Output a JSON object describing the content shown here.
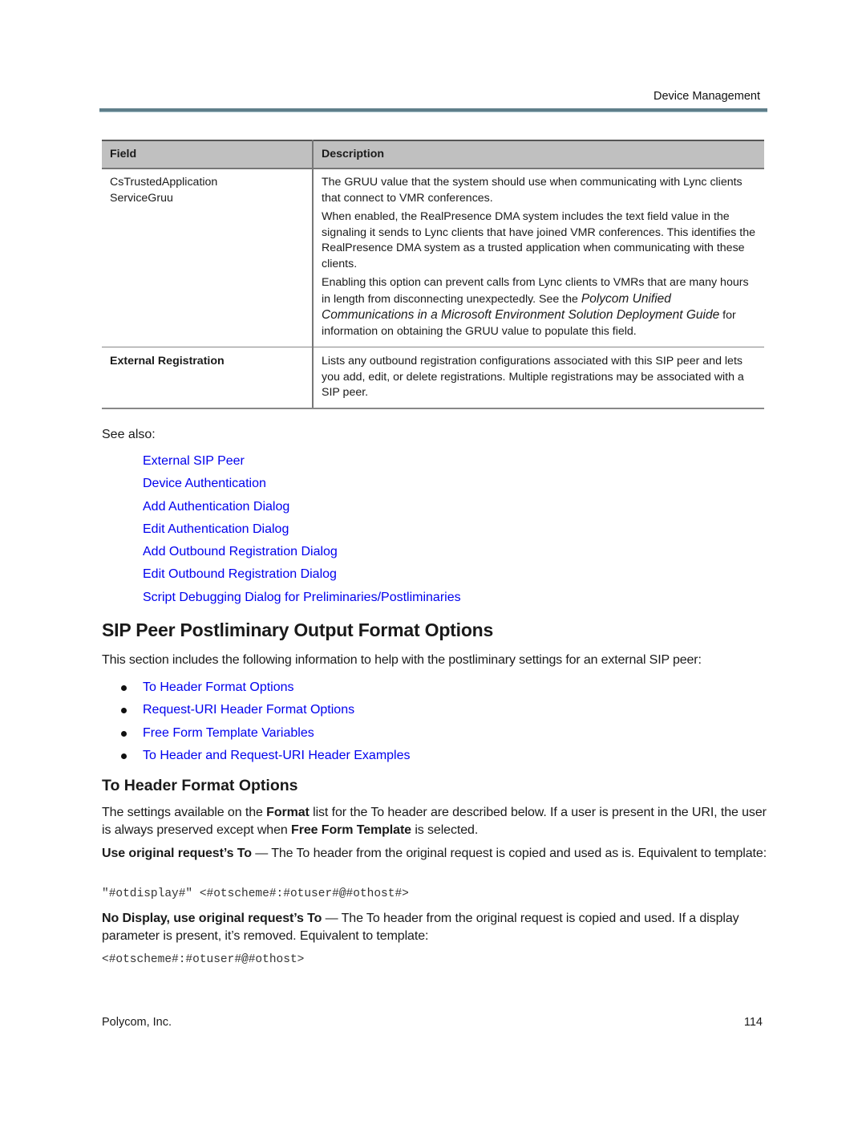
{
  "header": {
    "running_title": "Device Management"
  },
  "table": {
    "columns": [
      "Field",
      "Description"
    ],
    "rows": [
      {
        "field_line1": "CsTrustedApplication",
        "field_line2": "ServiceGruu",
        "desc_p1": "The GRUU value that the system should use when communicating with Lync clients that connect to VMR conferences.",
        "desc_p2": "When enabled, the RealPresence DMA system includes the text field value in the signaling it sends to Lync clients that have joined VMR conferences. This identifies the RealPresence DMA system as a trusted application when communicating with these clients.",
        "desc_p3_before": "Enabling this option can prevent calls from Lync clients to VMRs that are many hours in length from disconnecting unexpectedly. See the ",
        "desc_p3_italic": "Polycom Unified Communications in a Microsoft Environment Solution Deployment Guide",
        "desc_p3_after": " for information on obtaining the GRUU value to populate this field."
      },
      {
        "field": "External Registration",
        "desc": "Lists any outbound registration configurations associated with this SIP peer and lets you add, edit, or delete registrations. Multiple registrations may be associated with a SIP peer."
      }
    ]
  },
  "see_also": {
    "label": "See also:",
    "links": [
      "External SIP Peer",
      "Device Authentication",
      "Add Authentication Dialog",
      "Edit Authentication Dialog",
      "Add Outbound Registration Dialog",
      "Edit Outbound Registration Dialog",
      "Script Debugging Dialog for Preliminaries/Postliminaries"
    ]
  },
  "section": {
    "title": "SIP Peer Postliminary Output Format Options",
    "intro": "This section includes the following information to help with the postliminary settings for an external SIP peer:",
    "bullets": [
      "To Header Format Options",
      "Request-URI Header Format Options",
      "Free Form Template Variables",
      "To Header and Request-URI Header Examples"
    ]
  },
  "subsection": {
    "title": "To Header Format Options",
    "p1_a": "The settings available on the ",
    "p1_b": "Format",
    "p1_c": " list for the To header are described below. If a user is present in the URI, the user is always preserved except when ",
    "p1_d": "Free Form Template",
    "p1_e": " is selected.",
    "p2_bold": "Use original request’s To",
    "p2_rest": " — The To header from the original request is copied and used as is. Equivalent to template:",
    "code1": "\"#otdisplay#\" <#otscheme#:#otuser#@#othost#>",
    "p3_bold": "No Display, use original request’s To",
    "p3_rest": " — The To header from the original request is copied and used. If a display parameter is present, it’s removed. Equivalent to template:",
    "code2": "<#otscheme#:#otuser#@#othost>"
  },
  "footer": {
    "company": "Polycom, Inc.",
    "page_number": "114"
  },
  "colors": {
    "link": "#0000ee",
    "header_rule": "#5f7e8a",
    "table_header_bg": "#c0c0c0"
  }
}
